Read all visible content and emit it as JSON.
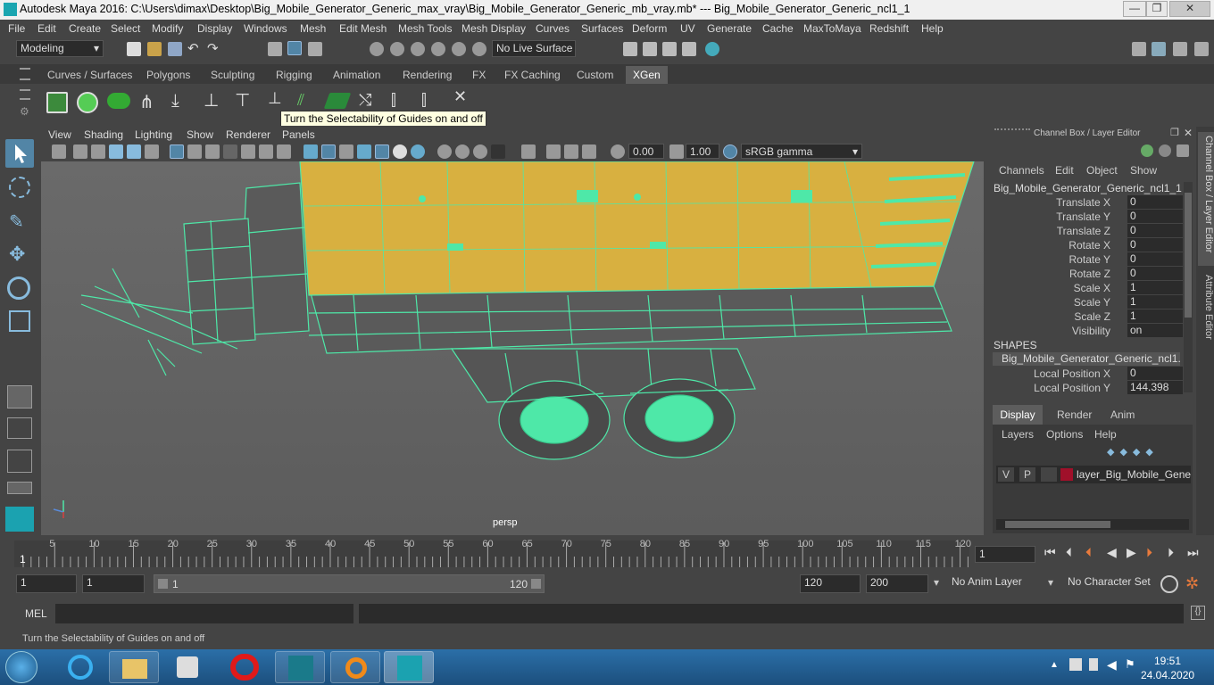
{
  "window": {
    "title": "Autodesk Maya 2016: C:\\Users\\dimax\\Desktop\\Big_Mobile_Generator_Generic_max_vray\\Big_Mobile_Generator_Generic_mb_vray.mb*   ---   Big_Mobile_Generator_Generic_ncl1_1"
  },
  "menubar": [
    "File",
    "Edit",
    "Create",
    "Select",
    "Modify",
    "Display",
    "Windows",
    "Mesh",
    "Edit Mesh",
    "Mesh Tools",
    "Mesh Display",
    "Curves",
    "Surfaces",
    "Deform",
    "UV",
    "Generate",
    "Cache",
    "MaxToMaya",
    "Redshift",
    "Help"
  ],
  "statusline": {
    "workspace": "Modeling",
    "live_surface": "No Live Surface"
  },
  "shelf_tabs": [
    "Curves / Surfaces",
    "Polygons",
    "Sculpting",
    "Rigging",
    "Animation",
    "Rendering",
    "FX",
    "FX Caching",
    "Custom",
    "XGen"
  ],
  "shelf_active": "XGen",
  "tooltip": "Turn the Selectability of Guides on and off",
  "viewport": {
    "menu": [
      "View",
      "Shading",
      "Lighting",
      "Show",
      "Renderer",
      "Panels"
    ],
    "near": "0.00",
    "far": "1.00",
    "colorspace": "sRGB gamma",
    "camera": "persp"
  },
  "channel_box": {
    "header": "Channel Box / Layer Editor",
    "menu": [
      "Channels",
      "Edit",
      "Object",
      "Show"
    ],
    "object": "Big_Mobile_Generator_Generic_ncl1_1",
    "attrs": [
      {
        "name": "Translate X",
        "value": "0"
      },
      {
        "name": "Translate Y",
        "value": "0"
      },
      {
        "name": "Translate Z",
        "value": "0"
      },
      {
        "name": "Rotate X",
        "value": "0"
      },
      {
        "name": "Rotate Y",
        "value": "0"
      },
      {
        "name": "Rotate Z",
        "value": "0"
      },
      {
        "name": "Scale X",
        "value": "1"
      },
      {
        "name": "Scale Y",
        "value": "1"
      },
      {
        "name": "Scale Z",
        "value": "1"
      },
      {
        "name": "Visibility",
        "value": "on"
      }
    ],
    "shapes_label": "SHAPES",
    "shape_name": "Big_Mobile_Generator_Generic_ncl1...",
    "shape_attrs": [
      {
        "name": "Local Position X",
        "value": "0"
      },
      {
        "name": "Local Position Y",
        "value": "144.398"
      }
    ],
    "layer_tabs": [
      "Display",
      "Render",
      "Anim"
    ],
    "layer_menu": [
      "Layers",
      "Options",
      "Help"
    ],
    "layer": {
      "v": "V",
      "p": "P",
      "name": "layer_Big_Mobile_Genera"
    },
    "layer_color": "#a0102a"
  },
  "side_tabs": [
    "Channel Box / Layer Editor",
    "Attribute Editor"
  ],
  "timeline": {
    "ticks": [
      "5",
      "10",
      "15",
      "20",
      "25",
      "30",
      "35",
      "40",
      "45",
      "50",
      "55",
      "60",
      "65",
      "70",
      "75",
      "80",
      "85",
      "90",
      "95",
      "100",
      "105",
      "110",
      "115",
      "120"
    ],
    "start_label": "1",
    "current_frame": "1"
  },
  "range": {
    "start": "1",
    "playback_start": "1",
    "slider_start": "1",
    "slider_end": "120",
    "playback_end": "120",
    "end": "200",
    "anim_layer": "No Anim Layer",
    "character_set": "No Character Set"
  },
  "mel": {
    "label": "MEL"
  },
  "helpline": "Turn the Selectability of Guides on and off",
  "clock": {
    "time": "19:51",
    "date": "24.04.2020"
  },
  "colors": {
    "wire": "#4ee8a8",
    "panel": "#d8b040",
    "ui_bg": "#444444",
    "highlight": "#5285a6"
  }
}
